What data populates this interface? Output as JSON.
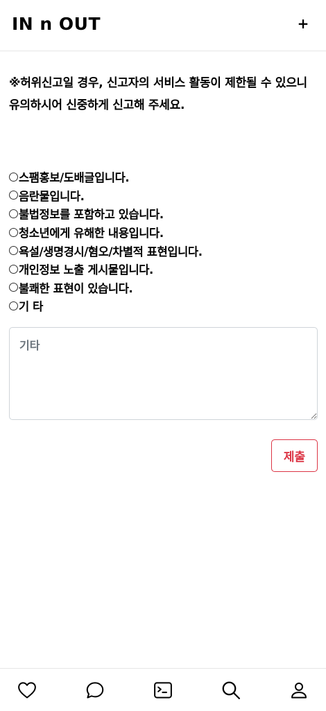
{
  "header": {
    "logo": "IN n OUT",
    "add_label": "+"
  },
  "notice": "※허위신고일 경우, 신고자의 서비스 활동이 제한될 수 있으니 유의하시어 신중하게 신고해 주세요.",
  "report_options": [
    "스팸홍보/도배글입니다.",
    "음란물입니다.",
    "불법정보를 포함하고 있습니다.",
    "청소년에게 유해한 내용입니다.",
    "욕설/생명경시/혐오/차별적 표현입니다.",
    "개인정보 노출 게시물입니다.",
    "불쾌한 표현이 있습니다.",
    "기 타"
  ],
  "etc_field": {
    "placeholder": "기타",
    "value": ""
  },
  "submit_label": "제출",
  "bottom_nav": {
    "items": [
      "heart-icon",
      "chat-icon",
      "terminal-icon",
      "search-icon",
      "profile-icon"
    ]
  },
  "colors": {
    "accent": "#dc3545",
    "border": "#cfd4d9"
  }
}
